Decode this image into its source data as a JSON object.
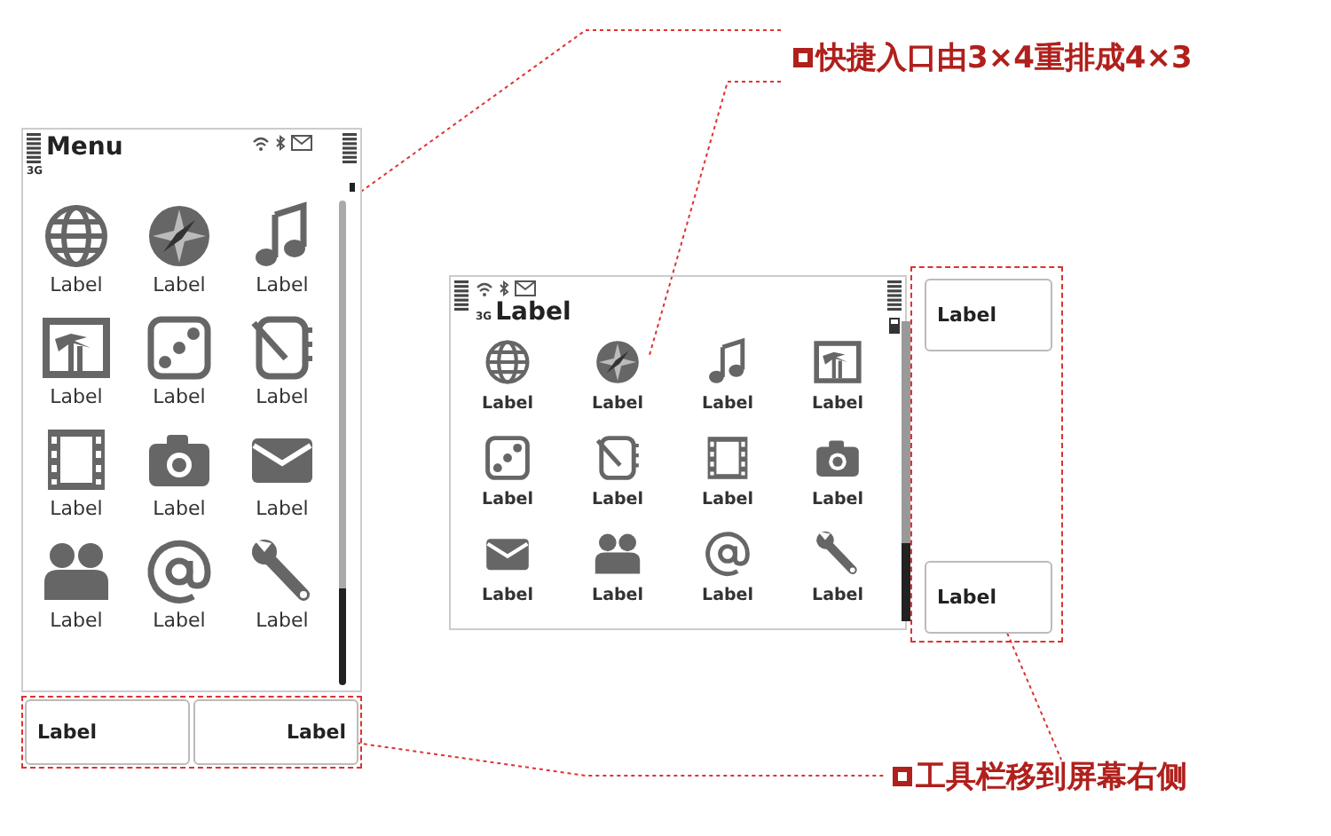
{
  "portrait": {
    "title": "Menu",
    "network": "3G",
    "apps": [
      {
        "kind": "globe",
        "label": "Label"
      },
      {
        "kind": "compass",
        "label": "Label"
      },
      {
        "kind": "music",
        "label": "Label"
      },
      {
        "kind": "picture",
        "label": "Label"
      },
      {
        "kind": "dice",
        "label": "Label"
      },
      {
        "kind": "notebook",
        "label": "Label"
      },
      {
        "kind": "film",
        "label": "Label"
      },
      {
        "kind": "camera",
        "label": "Label"
      },
      {
        "kind": "envelope",
        "label": "Label"
      },
      {
        "kind": "people",
        "label": "Label"
      },
      {
        "kind": "at",
        "label": "Label"
      },
      {
        "kind": "wrench",
        "label": "Label"
      }
    ],
    "toolbar": [
      {
        "label": "Label"
      },
      {
        "label": "Label"
      }
    ]
  },
  "landscape": {
    "title": "Label",
    "network": "3G",
    "apps": [
      {
        "kind": "globe",
        "label": "Label"
      },
      {
        "kind": "compass",
        "label": "Label"
      },
      {
        "kind": "music",
        "label": "Label"
      },
      {
        "kind": "picture",
        "label": "Label"
      },
      {
        "kind": "dice",
        "label": "Label"
      },
      {
        "kind": "notebook",
        "label": "Label"
      },
      {
        "kind": "film",
        "label": "Label"
      },
      {
        "kind": "camera",
        "label": "Label"
      },
      {
        "kind": "envelope",
        "label": "Label"
      },
      {
        "kind": "people",
        "label": "Label"
      },
      {
        "kind": "at",
        "label": "Label"
      },
      {
        "kind": "wrench",
        "label": "Label"
      }
    ],
    "toolbar": [
      {
        "label": "Label"
      },
      {
        "label": "Label"
      }
    ]
  },
  "callouts": [
    {
      "text": "快捷入口由3×4重排成4×3"
    },
    {
      "text": "工具栏移到屏幕右侧"
    }
  ]
}
